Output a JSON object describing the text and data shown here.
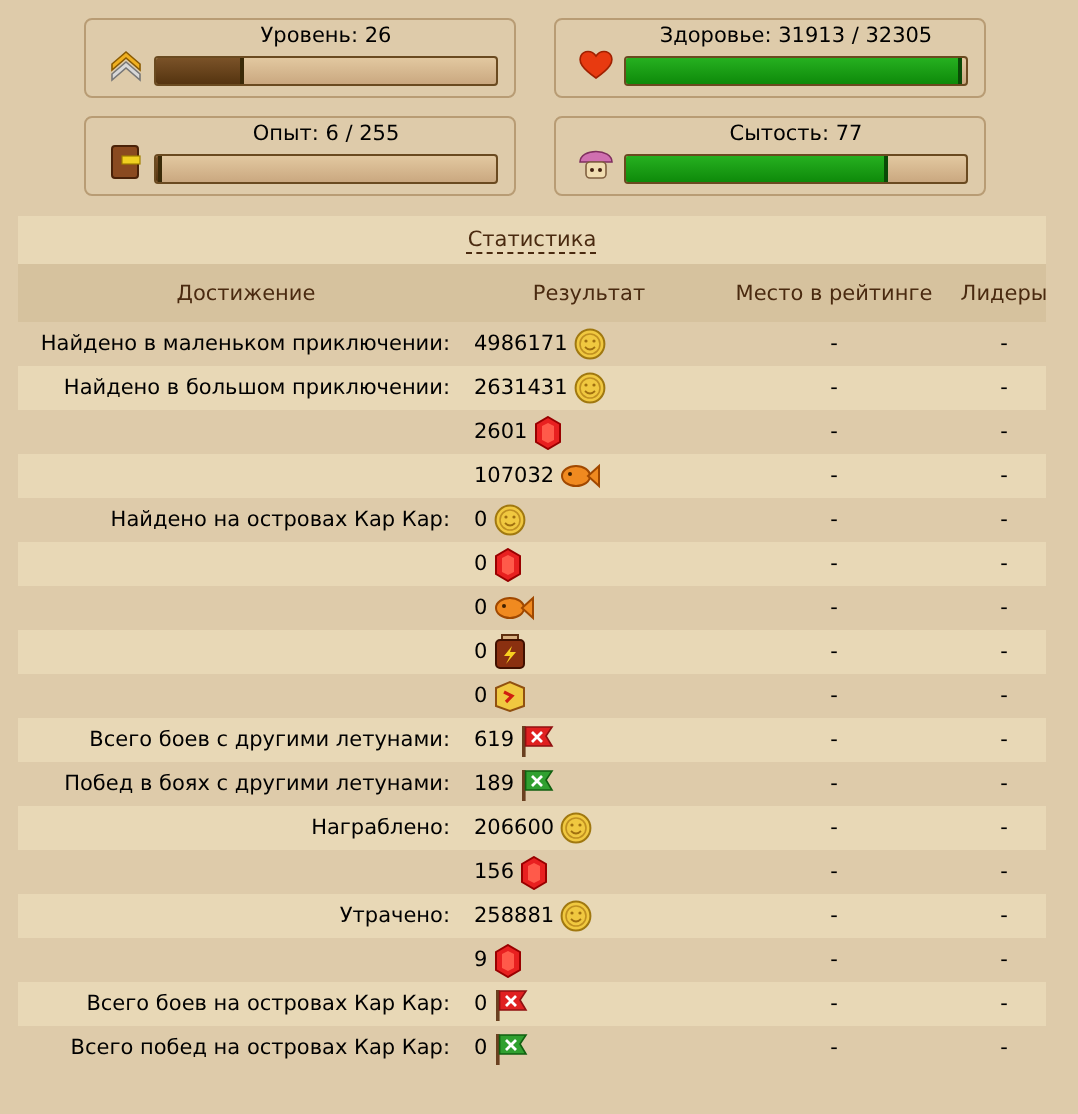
{
  "stats": [
    {
      "label": "Уровень: 26",
      "kind": "level",
      "level": 0.26
    },
    {
      "label": "Здоровье: 31913 / 32305",
      "kind": "health",
      "level": 0.988
    },
    {
      "label": "Опыт: 6 / 255",
      "kind": "experience",
      "level": 0.02
    },
    {
      "label": "Сытость: 77",
      "kind": "satiety",
      "level": 0.77
    }
  ],
  "table": {
    "title": "Статистика",
    "columns": [
      "Достижение",
      "Результат",
      "Место в рейтинге",
      "Лидеры"
    ],
    "rows": [
      {
        "achievement": "Найдено в маленьком приключении:",
        "result": "4986171",
        "kind": "coin",
        "rank": "-",
        "leaders": "-"
      },
      {
        "achievement": "Найдено в большом приключении:",
        "result": "2631431",
        "kind": "coin",
        "rank": "-",
        "leaders": "-"
      },
      {
        "result": "2601",
        "kind": "gem",
        "rank": "-",
        "leaders": "-"
      },
      {
        "result": "107032",
        "kind": "fish",
        "rank": "-",
        "leaders": "-"
      },
      {
        "achievement": "Найдено на островах Кар Кар:",
        "result": "0",
        "kind": "coin",
        "rank": "-",
        "leaders": "-"
      },
      {
        "result": "0",
        "kind": "gem",
        "rank": "-",
        "leaders": "-"
      },
      {
        "result": "0",
        "kind": "fish",
        "rank": "-",
        "leaders": "-"
      },
      {
        "result": "0",
        "kind": "jar",
        "rank": "-",
        "leaders": "-"
      },
      {
        "result": "0",
        "kind": "box",
        "rank": "-",
        "leaders": "-"
      },
      {
        "achievement": "Всего боев с другими летунами:",
        "result": "619",
        "kind": "red-flag",
        "rank": "-",
        "leaders": "-"
      },
      {
        "achievement": "Побед в боях с другими летунами:",
        "result": "189",
        "kind": "green-flag",
        "rank": "-",
        "leaders": "-"
      },
      {
        "achievement": "Награблено:",
        "result": "206600",
        "kind": "coin",
        "rank": "-",
        "leaders": "-"
      },
      {
        "result": "156",
        "kind": "gem",
        "rank": "-",
        "leaders": "-"
      },
      {
        "achievement": "Утрачено:",
        "result": "258881",
        "kind": "coin",
        "rank": "-",
        "leaders": "-"
      },
      {
        "result": "9",
        "kind": "gem",
        "rank": "-",
        "leaders": "-"
      },
      {
        "achievement": "Всего боев на островах Кар Кар:",
        "result": "0",
        "kind": "red-flag",
        "rank": "-",
        "leaders": "-"
      },
      {
        "achievement": "Всего побед на островах Кар Кар:",
        "result": "0",
        "kind": "green-flag",
        "rank": "-",
        "leaders": "-"
      }
    ]
  }
}
